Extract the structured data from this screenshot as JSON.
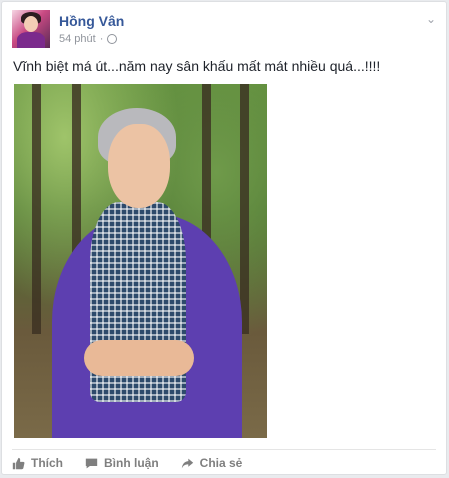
{
  "post": {
    "author": "Hồng Vân",
    "time": "54 phút",
    "separator": "·",
    "privacy_icon": "globe-icon",
    "menu_icon": "chevron-down-icon",
    "text": "Vĩnh biệt má út...năm nay sân khấu mất mát nhiều quá...!!!!"
  },
  "actions": [
    {
      "label": "Thích",
      "icon": "thumbs-up-icon"
    },
    {
      "label": "Bình luận",
      "icon": "comment-icon"
    },
    {
      "label": "Chia sẻ",
      "icon": "share-icon"
    }
  ],
  "colors": {
    "author_link": "#365899",
    "meta_text": "#90949c",
    "action_text": "#7f7f7f",
    "dress": "#5d3fb0"
  }
}
